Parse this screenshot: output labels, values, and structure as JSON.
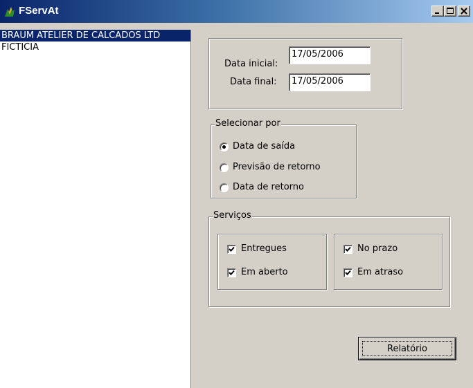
{
  "window": {
    "title": "FServAt"
  },
  "list": {
    "items": [
      "BRAUM ATELIER DE CALCADOS LTD",
      "FICTICIA"
    ],
    "selected_index": 0
  },
  "dates": {
    "start_label": "Data inicial:",
    "start_value": "17/05/2006",
    "end_label": "Data final:",
    "end_value": "17/05/2006"
  },
  "select_by": {
    "legend": "Selecionar por",
    "options": [
      "Data de saída",
      "Previsão de retorno",
      "Data de retorno"
    ],
    "selected": "Data de saída"
  },
  "services": {
    "legend": "Serviços",
    "checkboxes": [
      {
        "label": "Entregues",
        "checked": true
      },
      {
        "label": "Em aberto",
        "checked": true
      },
      {
        "label": "No prazo",
        "checked": true
      },
      {
        "label": "Em atraso",
        "checked": true
      }
    ]
  },
  "actions": {
    "report_label": "Relatório"
  },
  "icons": {
    "app": "app-icon",
    "minimize": "minimize-icon",
    "maximize": "maximize-icon",
    "close": "close-icon"
  },
  "colors": {
    "titlebar_start": "#0a246a",
    "titlebar_end": "#a6caf0",
    "selection": "#0a246a",
    "face": "#d4d0c8"
  }
}
